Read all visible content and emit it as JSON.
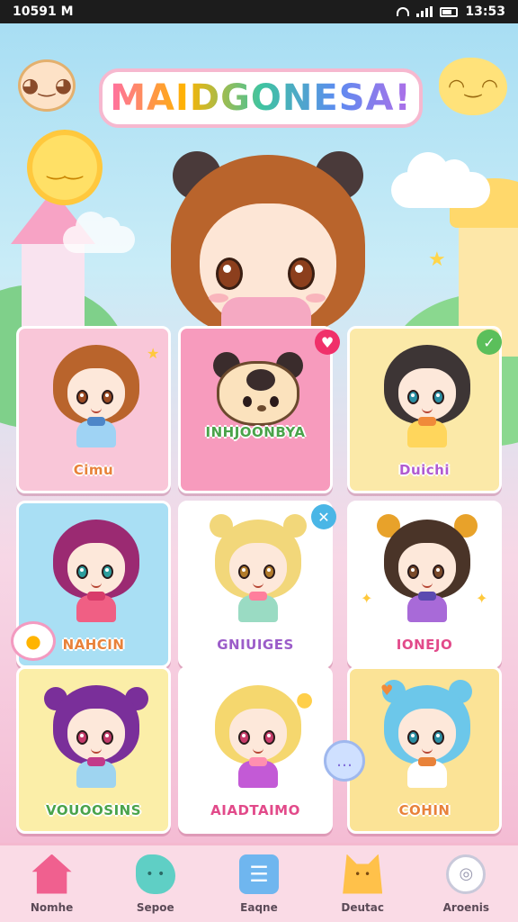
{
  "status_bar": {
    "time": "10591 M",
    "clock_right": "13:53"
  },
  "game": {
    "title": "MAIDGONESA!"
  },
  "characters": [
    {
      "name": "Cimu",
      "hair": "#b9642c",
      "eye": "#9b4a22",
      "outfit": "#9fd3f4",
      "bow": "#4d86c8",
      "bg": "#f9c6d8",
      "text_color": "#e8823a"
    },
    {
      "name": "INHJOONBYA",
      "bg": "#f79bbd",
      "text_color": "#4aa34a"
    },
    {
      "name": "Duichi",
      "hair": "#3d3535",
      "eye": "#2a8fa4",
      "outfit": "#ffd65c",
      "bow": "#f08a3a",
      "bg": "#fbe9a8",
      "text_color": "#b05ad0"
    },
    {
      "name": "NAHCIN",
      "hair": "#9b2a72",
      "eye": "#2c9d9d",
      "outfit": "#f05f84",
      "bow": "#d83c6a",
      "bg": "#a9dff4",
      "text_color": "#e8823a"
    },
    {
      "name": "GNIUIGES",
      "hair": "#f2d77a",
      "eye": "#b27b2a",
      "outfit": "#9adbc3",
      "bow": "#ff7f9c",
      "bg": "#ffffff",
      "text_color": "#9b5cc9"
    },
    {
      "name": "IONEJO",
      "hair": "#4a3428",
      "eye": "#7a4a2a",
      "outfit": "#a86ad8",
      "bow": "#5b4ab0",
      "bg": "#ffffff",
      "text_color": "#e24a8a"
    },
    {
      "name": "VOUOOSINS",
      "hair": "#7a2f9a",
      "eye": "#c43a6a",
      "outfit": "#9ed4f0",
      "bow": "#c23a8a",
      "bg": "#fbeea8",
      "text_color": "#4aa34a"
    },
    {
      "name": "AIADTAIMO",
      "hair": "#f5d76e",
      "eye": "#c93c6a",
      "outfit": "#c35ad6",
      "bow": "#ff8fb0",
      "bg": "#ffffff",
      "text_color": "#e24a8a"
    },
    {
      "name": "COHIN",
      "hair": "#6cc7ea",
      "eye": "#2a8fa4",
      "outfit": "#ffffff",
      "bow": "#e8823a",
      "bg": "#fbe396",
      "text_color": "#e8823a"
    }
  ],
  "nav": [
    {
      "label": "Nomhe",
      "icon": "home-icon",
      "color": "#f0608f"
    },
    {
      "label": "Sepoe",
      "icon": "blob-icon",
      "color": "#5fcfc5"
    },
    {
      "label": "Eaqne",
      "icon": "menu-icon",
      "color": "#6fb6ef"
    },
    {
      "label": "Deutac",
      "icon": "cat-icon",
      "color": "#ffc14a"
    },
    {
      "label": "Aroenis",
      "icon": "chat-icon",
      "color": "#dcdcec"
    }
  ],
  "colors": {
    "accent": "#f39ac0",
    "nav_bg": "#fadbe6"
  }
}
